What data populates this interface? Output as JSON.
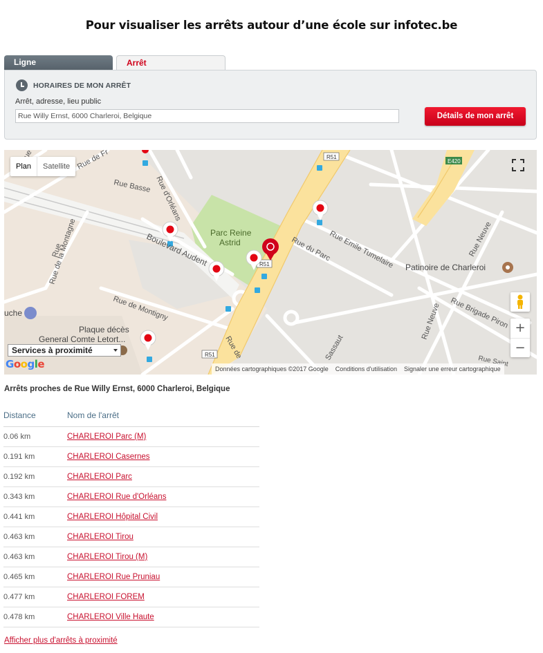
{
  "headline": "Pour visualiser les arrêts autour d’une école sur infotec.be",
  "tabs": {
    "ligne": "Ligne",
    "arret": "Arrêt"
  },
  "panel": {
    "title": "HORAIRES DE MON ARRÊT",
    "label": "Arrêt, adresse, lieu public",
    "input_value": "Rue Willy Ernst, 6000 Charleroi, Belgique",
    "button": "Détails de mon arrêt"
  },
  "map": {
    "type_plan": "Plan",
    "type_satellite": "Satellite",
    "services": "Services à proximité",
    "google": "Google",
    "zoom_in": "+",
    "zoom_out": "−",
    "attribution": {
      "data": "Données cartographiques ©2017 Google",
      "terms": "Conditions d'utilisation",
      "report": "Signaler une erreur cartographique"
    },
    "labels": {
      "parc": "Parc Reine",
      "parc2": "Astrid",
      "patinoire": "Patinoire de Charleroi",
      "rue_emile": "Rue Emile Tumelaire",
      "rue_parc": "Rue du Parc",
      "rue_neuve": "Rue Neuve",
      "rue_neuve2": "Rue Neuve",
      "rue_brigade": "Rue Brigade Piron",
      "rue_montigny": "Rue de Montigny",
      "rue_montagne": "Rue de la Montagne",
      "boulevard": "Boulevard Audent",
      "rue_orleans": "Rue d'Orléans",
      "rue_basse": "Rue Basse",
      "plaque1": "Plaque décès",
      "plaque2": "General Comte Letort...",
      "uche": "uche",
      "r51a": "R51",
      "r51b": "R51",
      "r51c": "R51",
      "e420": "E420",
      "rue_de_fr": "Rue de Fr",
      "rue_de": "Rue de",
      "rue_saint": "Rue Saint",
      "rue_sainte": "Rue S...",
      "sassaut": "Sassaut",
      "rue_side": "Rue",
      "rue_topleft": "Rue de"
    }
  },
  "near_title": "Arrêts proches de Rue Willy Ernst, 6000 Charleroi, Belgique",
  "table": {
    "headers": {
      "distance": "Distance",
      "name": "Nom de l'arrêt"
    },
    "rows": [
      {
        "distance": "0.06 km",
        "name": "CHARLEROI Parc (M)"
      },
      {
        "distance": "0.191 km",
        "name": "CHARLEROI Casernes"
      },
      {
        "distance": "0.192 km",
        "name": "CHARLEROI Parc"
      },
      {
        "distance": "0.343 km",
        "name": "CHARLEROI Rue d'Orléans"
      },
      {
        "distance": "0.441 km",
        "name": "CHARLEROI Hôpital Civil"
      },
      {
        "distance": "0.463 km",
        "name": "CHARLEROI Tirou"
      },
      {
        "distance": "0.463 km",
        "name": "CHARLEROI Tirou (M)"
      },
      {
        "distance": "0.465 km",
        "name": "CHARLEROI Rue Pruniau"
      },
      {
        "distance": "0.477 km",
        "name": "CHARLEROI FOREM"
      },
      {
        "distance": "0.478 km",
        "name": "CHARLEROI Ville Haute"
      }
    ]
  },
  "more_link": "Afficher plus d'arrêts à proximité"
}
